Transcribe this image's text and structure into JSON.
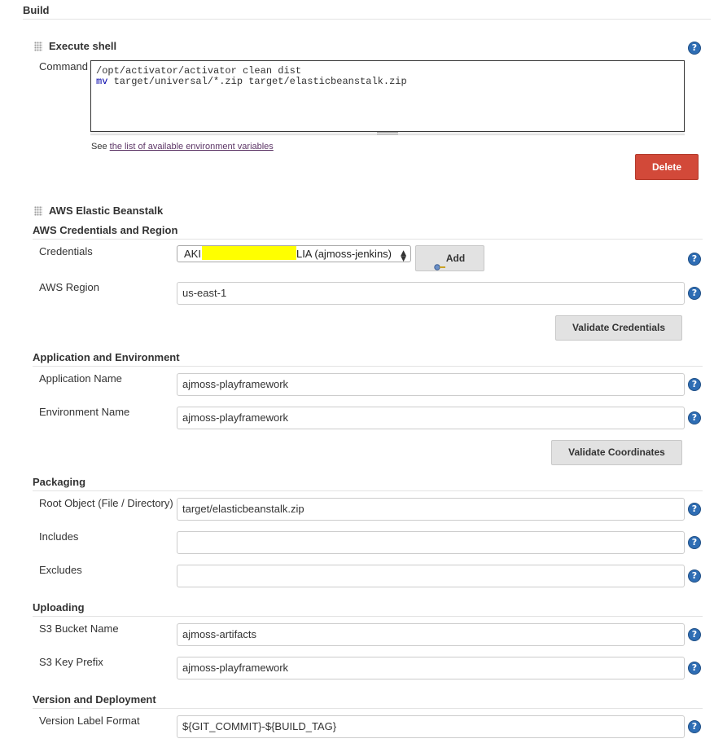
{
  "build": {
    "title": "Build"
  },
  "execute_shell": {
    "title": "Execute shell",
    "command_label": "Command",
    "command_line1": "/opt/activator/activator clean dist",
    "command_line2_keyword": "mv",
    "command_line2_rest": " target/universal/*.zip target/elasticbeanstalk.zip",
    "see_text": "See",
    "env_link": "the list of available environment variables",
    "delete_label": "Delete"
  },
  "beanstalk": {
    "title": "AWS Elastic Beanstalk",
    "credentials_section": {
      "title": "AWS Credentials and Region",
      "credentials_label": "Credentials",
      "credentials_prefix": "AKI",
      "credentials_suffix": "LIA (ajmoss-jenkins)",
      "add_label": "Add",
      "region_label": "AWS Region",
      "region_value": "us-east-1",
      "validate_label": "Validate Credentials"
    },
    "app_section": {
      "title": "Application and Environment",
      "app_name_label": "Application Name",
      "app_name_value": "ajmoss-playframework",
      "env_name_label": "Environment Name",
      "env_name_value": "ajmoss-playframework",
      "validate_label": "Validate Coordinates"
    },
    "packaging": {
      "title": "Packaging",
      "root_label": "Root Object (File / Directory)",
      "root_value": "target/elasticbeanstalk.zip",
      "includes_label": "Includes",
      "includes_value": "",
      "excludes_label": "Excludes",
      "excludes_value": ""
    },
    "uploading": {
      "title": "Uploading",
      "bucket_label": "S3 Bucket Name",
      "bucket_value": "ajmoss-artifacts",
      "prefix_label": "S3 Key Prefix",
      "prefix_value": "ajmoss-playframework"
    },
    "versioning": {
      "title": "Version and Deployment",
      "label_format_label": "Version Label Format",
      "label_format_value": "${GIT_COMMIT}-${BUILD_TAG}"
    }
  },
  "help_icon": "?",
  "colors": {
    "delete": "#d24939",
    "help": "#2e6db4",
    "redaction": "#ffff00"
  }
}
